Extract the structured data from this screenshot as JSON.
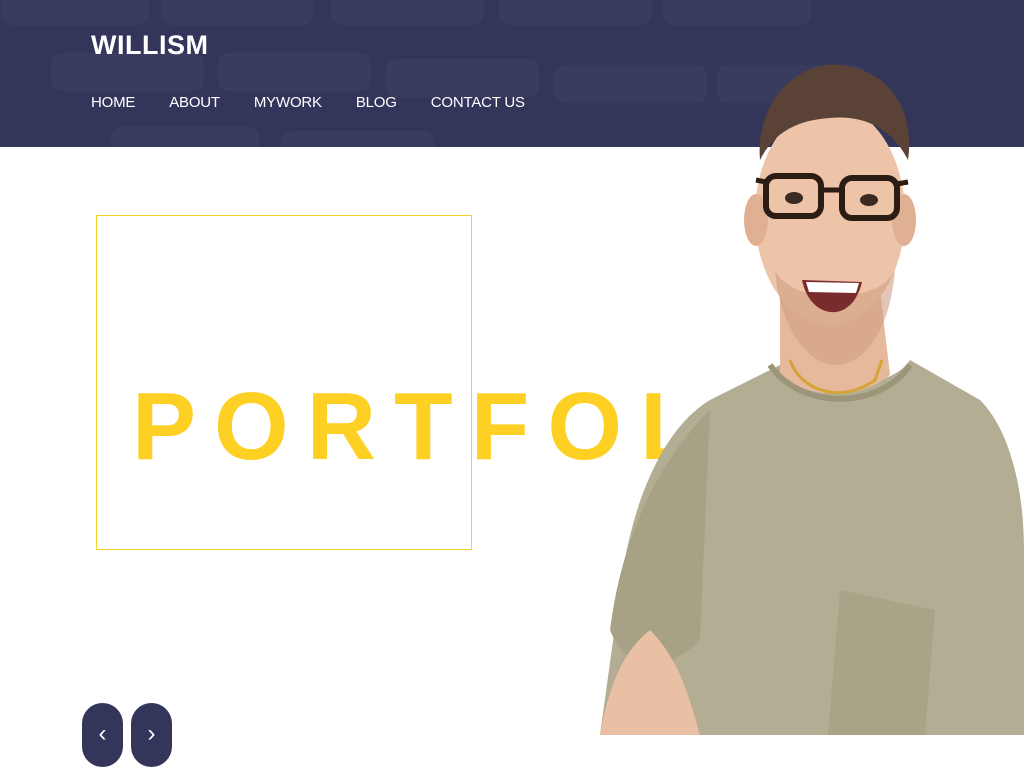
{
  "header": {
    "logo": "WILLISM",
    "nav": [
      "HOME",
      "ABOUT",
      "MYWORK",
      "BLOG",
      "CONTACT US"
    ]
  },
  "hero": {
    "title": "PORTFOLIO"
  },
  "slider": {
    "prev_icon": "‹",
    "next_icon": "›"
  },
  "colors": {
    "header_bg": "#33355a",
    "accent_yellow": "#fdd023",
    "shirt": "#b3ad93",
    "background": "#ffffff"
  }
}
